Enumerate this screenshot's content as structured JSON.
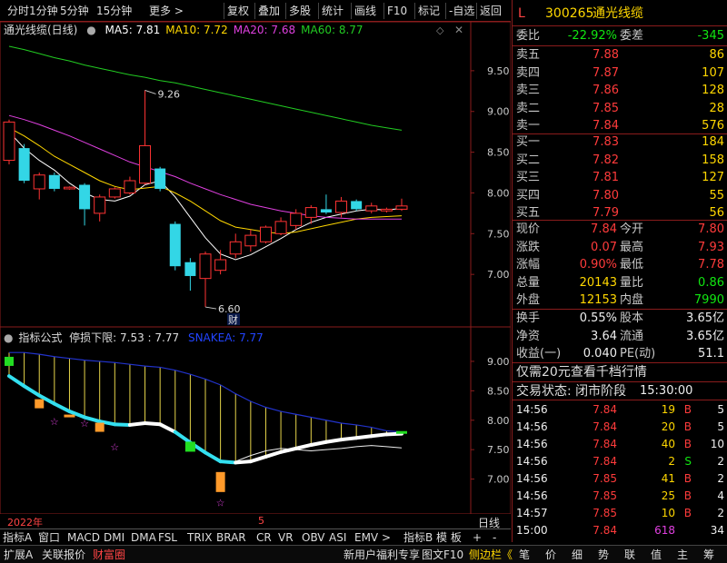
{
  "toolbar": {
    "left": [
      "分时",
      "1分钟",
      "5分钟",
      "15分钟",
      "更多 >"
    ],
    "right": [
      "复权",
      "叠加",
      "多股",
      "统计",
      "画线",
      "F10",
      "标记",
      "-自选",
      "返回"
    ]
  },
  "main": {
    "title": "通光线缆(日线)",
    "ma": [
      {
        "label": "MA5: 7.81",
        "color": "#ffffff"
      },
      {
        "label": "MA10: 7.72",
        "color": "#ffd700"
      },
      {
        "label": "MA20: 7.68",
        "color": "#e040e0"
      },
      {
        "label": "MA60: 8.77",
        "color": "#22cc22"
      }
    ],
    "high_label": "9.26",
    "low_label": "6.60",
    "cai_label": "财",
    "y_ticks": [
      "9.50",
      "9.00",
      "8.50",
      "8.00",
      "7.50",
      "7.00"
    ]
  },
  "indicator": {
    "title": "指标公式",
    "params": "停损下限: 7.53 : 7.77",
    "snake": "SNAKEA: 7.77",
    "y_ticks": [
      "9.00",
      "8.50",
      "8.00",
      "7.50",
      "7.00"
    ]
  },
  "axis": {
    "year": "2022年",
    "month": "5",
    "period": "日线"
  },
  "tabs": [
    "指标A",
    "窗口",
    "MACD",
    "DMI",
    "DMA",
    "FSL",
    "TRIX",
    "BRAR",
    "CR",
    "VR",
    "OBV",
    "ASI",
    "EMV",
    ">",
    "指标B",
    "模 板",
    "+",
    "-"
  ],
  "status": {
    "left": [
      "扩展A",
      "关联报价",
      "财富圈"
    ],
    "middle": [
      "新用户福利专享",
      "图文F10",
      "侧边栏《"
    ],
    "right": [
      "笔",
      "价",
      "细",
      "势",
      "联",
      "值",
      "主",
      "筹"
    ]
  },
  "quote": {
    "flag": "L",
    "code": "300265",
    "name": "通光线缆",
    "weibi_label": "委比",
    "weibi": "-22.92%",
    "weicha_label": "委差",
    "weicha": "-345",
    "asks": [
      {
        "label": "卖五",
        "price": "7.88",
        "vol": "86"
      },
      {
        "label": "卖四",
        "price": "7.87",
        "vol": "107"
      },
      {
        "label": "卖三",
        "price": "7.86",
        "vol": "128"
      },
      {
        "label": "卖二",
        "price": "7.85",
        "vol": "28"
      },
      {
        "label": "卖一",
        "price": "7.84",
        "vol": "576"
      }
    ],
    "bids": [
      {
        "label": "买一",
        "price": "7.83",
        "vol": "184"
      },
      {
        "label": "买二",
        "price": "7.82",
        "vol": "158"
      },
      {
        "label": "买三",
        "price": "7.81",
        "vol": "127"
      },
      {
        "label": "买四",
        "price": "7.80",
        "vol": "55"
      },
      {
        "label": "买五",
        "price": "7.79",
        "vol": "56"
      }
    ],
    "stats": [
      {
        "l1": "现价",
        "v1": "7.84",
        "c1": "red",
        "l2": "今开",
        "v2": "7.80",
        "c2": "red"
      },
      {
        "l1": "涨跌",
        "v1": "0.07",
        "c1": "red",
        "l2": "最高",
        "v2": "7.93",
        "c2": "red"
      },
      {
        "l1": "涨幅",
        "v1": "0.90%",
        "c1": "red",
        "l2": "最低",
        "v2": "7.78",
        "c2": "red"
      },
      {
        "l1": "总量",
        "v1": "20143",
        "c1": "yellow",
        "l2": "量比",
        "v2": "0.86",
        "c2": "green"
      },
      {
        "l1": "外盘",
        "v1": "12153",
        "c1": "yellow",
        "l2": "内盘",
        "v2": "7990",
        "c2": "green"
      }
    ],
    "stats2": [
      {
        "l1": "换手",
        "v1": "0.55%",
        "l2": "股本",
        "v2": "3.65亿"
      },
      {
        "l1": "净资",
        "v1": "3.64",
        "l2": "流通",
        "v2": "3.65亿"
      },
      {
        "l1": "收益(一)",
        "v1": "0.040",
        "l2": "PE(动)",
        "v2": "51.1"
      }
    ],
    "promo": "仅需20元查看千档行情",
    "trade_state_label": "交易状态: 闭市阶段",
    "trade_time": "15:30:00",
    "ticks": [
      {
        "t": "14:56",
        "p": "7.84",
        "v": "19",
        "s": "B",
        "n": "5",
        "sc": "red"
      },
      {
        "t": "14:56",
        "p": "7.84",
        "v": "20",
        "s": "B",
        "n": "5",
        "sc": "red"
      },
      {
        "t": "14:56",
        "p": "7.84",
        "v": "40",
        "s": "B",
        "n": "10",
        "sc": "red"
      },
      {
        "t": "14:56",
        "p": "7.84",
        "v": "2",
        "s": "S",
        "n": "2",
        "sc": "green"
      },
      {
        "t": "14:56",
        "p": "7.85",
        "v": "41",
        "s": "B",
        "n": "2",
        "sc": "red"
      },
      {
        "t": "14:56",
        "p": "7.85",
        "v": "25",
        "s": "B",
        "n": "4",
        "sc": "red"
      },
      {
        "t": "14:57",
        "p": "7.85",
        "v": "10",
        "s": "B",
        "n": "2",
        "sc": "red"
      },
      {
        "t": "15:00",
        "p": "7.84",
        "v": "618",
        "s": "",
        "n": "34",
        "sc": "red"
      }
    ]
  },
  "chart_data": {
    "type": "candlestick",
    "y_range": [
      6.4,
      9.9
    ],
    "candles": [
      {
        "o": 8.4,
        "c": 8.87,
        "h": 8.9,
        "l": 8.35
      },
      {
        "o": 8.55,
        "c": 8.15,
        "h": 8.6,
        "l": 8.12
      },
      {
        "o": 8.05,
        "c": 8.22,
        "h": 8.25,
        "l": 7.92
      },
      {
        "o": 8.22,
        "c": 8.05,
        "h": 8.25,
        "l": 8.02
      },
      {
        "o": 8.05,
        "c": 8.07,
        "h": 8.08,
        "l": 8.04
      },
      {
        "o": 8.1,
        "c": 7.8,
        "h": 8.12,
        "l": 7.6
      },
      {
        "o": 7.75,
        "c": 7.95,
        "h": 7.98,
        "l": 7.65
      },
      {
        "o": 7.95,
        "c": 8.05,
        "h": 8.07,
        "l": 7.93
      },
      {
        "o": 8.0,
        "c": 8.15,
        "h": 8.2,
        "l": 7.98
      },
      {
        "o": 8.12,
        "c": 8.58,
        "h": 9.26,
        "l": 8.1
      },
      {
        "o": 8.3,
        "c": 8.05,
        "h": 8.32,
        "l": 8.02
      },
      {
        "o": 7.62,
        "c": 7.1,
        "h": 7.65,
        "l": 7.05
      },
      {
        "o": 7.15,
        "c": 6.98,
        "h": 7.2,
        "l": 6.8
      },
      {
        "o": 6.95,
        "c": 7.25,
        "h": 7.28,
        "l": 6.6
      },
      {
        "o": 7.05,
        "c": 7.18,
        "h": 7.3,
        "l": 7.0
      },
      {
        "o": 7.25,
        "c": 7.4,
        "h": 7.5,
        "l": 7.2
      },
      {
        "o": 7.35,
        "c": 7.48,
        "h": 7.55,
        "l": 7.28
      },
      {
        "o": 7.4,
        "c": 7.58,
        "h": 7.6,
        "l": 7.38
      },
      {
        "o": 7.5,
        "c": 7.65,
        "h": 7.7,
        "l": 7.48
      },
      {
        "o": 7.6,
        "c": 7.75,
        "h": 7.8,
        "l": 7.55
      },
      {
        "o": 7.7,
        "c": 7.82,
        "h": 7.85,
        "l": 7.62
      },
      {
        "o": 7.8,
        "c": 7.76,
        "h": 7.98,
        "l": 7.74
      },
      {
        "o": 7.76,
        "c": 7.9,
        "h": 7.95,
        "l": 7.7
      },
      {
        "o": 7.9,
        "c": 7.8,
        "h": 7.92,
        "l": 7.78
      },
      {
        "o": 7.78,
        "c": 7.84,
        "h": 7.88,
        "l": 7.75
      },
      {
        "o": 7.78,
        "c": 7.8,
        "h": 7.82,
        "l": 7.76
      },
      {
        "o": 7.8,
        "c": 7.84,
        "h": 7.93,
        "l": 7.78
      }
    ],
    "ma": {
      "MA5": [
        8.75,
        8.55,
        8.4,
        8.28,
        8.12,
        8.0,
        7.92,
        7.9,
        7.96,
        8.1,
        8.15,
        7.95,
        7.7,
        7.45,
        7.25,
        7.18,
        7.24,
        7.34,
        7.44,
        7.55,
        7.64,
        7.7,
        7.74,
        7.78,
        7.8,
        7.79,
        7.81
      ],
      "MA10": [
        8.8,
        8.7,
        8.58,
        8.45,
        8.35,
        8.25,
        8.15,
        8.08,
        8.04,
        8.06,
        8.08,
        8.0,
        7.9,
        7.78,
        7.66,
        7.58,
        7.55,
        7.52,
        7.5,
        7.52,
        7.56,
        7.6,
        7.64,
        7.68,
        7.7,
        7.71,
        7.72
      ],
      "MA20": [
        8.95,
        8.9,
        8.84,
        8.77,
        8.7,
        8.62,
        8.54,
        8.46,
        8.38,
        8.32,
        8.26,
        8.2,
        8.12,
        8.05,
        7.98,
        7.92,
        7.86,
        7.82,
        7.78,
        7.75,
        7.72,
        7.7,
        7.69,
        7.68,
        7.68,
        7.68,
        7.68
      ],
      "MA60": [
        9.8,
        9.76,
        9.71,
        9.66,
        9.62,
        9.57,
        9.53,
        9.49,
        9.45,
        9.42,
        9.38,
        9.35,
        9.31,
        9.27,
        9.23,
        9.19,
        9.15,
        9.11,
        9.07,
        9.03,
        8.99,
        8.95,
        8.91,
        8.87,
        8.83,
        8.8,
        8.77
      ]
    },
    "indicator": {
      "y_range": [
        6.5,
        9.4
      ],
      "upper": [
        9.15,
        9.15,
        9.12,
        9.08,
        9.05,
        9.02,
        9.0,
        8.98,
        8.95,
        8.92,
        8.9,
        8.85,
        8.78,
        8.7,
        8.6,
        8.45,
        8.32,
        8.22,
        8.15,
        8.1,
        8.05,
        8.0,
        7.95,
        7.92,
        7.88,
        7.82,
        7.8
      ],
      "snake": [
        8.75,
        8.58,
        8.42,
        8.28,
        8.15,
        8.05,
        7.98,
        7.93,
        7.92,
        7.95,
        7.93,
        7.8,
        7.62,
        7.45,
        7.3,
        7.28,
        7.3,
        7.38,
        7.46,
        7.52,
        7.58,
        7.63,
        7.67,
        7.7,
        7.73,
        7.76,
        7.77
      ],
      "snake_color": [
        "cyan",
        "cyan",
        "cyan",
        "cyan",
        "cyan",
        "cyan",
        "cyan",
        "cyan",
        "white",
        "white",
        "white",
        "cyan",
        "cyan",
        "cyan",
        "cyan",
        "white",
        "white",
        "white",
        "white",
        "white",
        "white",
        "white",
        "white",
        "white",
        "white",
        "white",
        "white"
      ],
      "stop_low": [
        0,
        0,
        0,
        0,
        0,
        0,
        0,
        0,
        0,
        0,
        0,
        0,
        0,
        0,
        0,
        7.3,
        7.4,
        7.48,
        7.52,
        7.5,
        7.48,
        7.5,
        7.52,
        7.55,
        7.57,
        7.55,
        7.53
      ]
    }
  }
}
